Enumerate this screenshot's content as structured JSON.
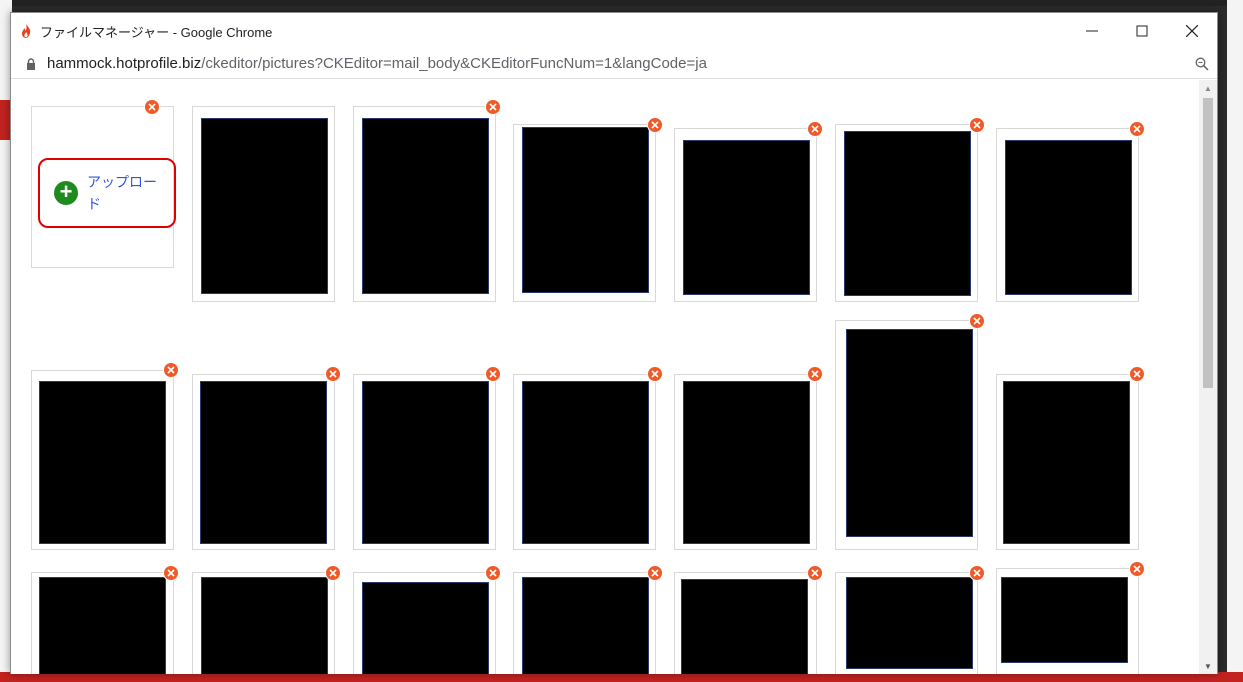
{
  "window": {
    "title": "ファイルマネージャー - Google Chrome",
    "url_host": "hammock.hotprofile.biz",
    "url_path": "/ckeditor/pictures?CKEditor=mail_body&CKEditorFuncNum=1&langCode=ja",
    "controls": [
      "minimize-icon",
      "maximize-icon",
      "close-icon"
    ]
  },
  "upload": {
    "label": "アップロード",
    "icon": "plus-circle-icon"
  },
  "colors": {
    "accent_red": "#e00000",
    "delete_orange": "#f05a28",
    "upload_green": "#1f8a1f",
    "link_blue": "#3355dd"
  },
  "image_count": 20
}
